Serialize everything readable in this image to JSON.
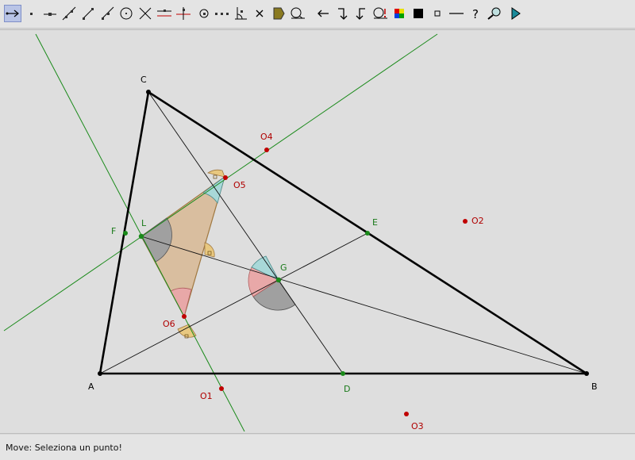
{
  "toolbar": {
    "tools": [
      {
        "name": "move-tool-icon",
        "active": true
      },
      {
        "name": "point-tool-icon"
      },
      {
        "name": "point-on-line-tool-icon"
      },
      {
        "name": "line-tool-icon"
      },
      {
        "name": "segment-tool-icon"
      },
      {
        "name": "ray-tool-icon"
      },
      {
        "name": "circle-tool-icon"
      },
      {
        "name": "intersection-tool-icon"
      },
      {
        "name": "parallel-tool-icon"
      },
      {
        "name": "perpendicular-tool-icon"
      },
      {
        "name": "center-tool-icon"
      },
      {
        "name": "midpoint-tool-icon"
      },
      {
        "name": "angle-tool-icon"
      },
      {
        "name": "delete-tool-icon"
      },
      {
        "name": "polygon-fill-tool-icon"
      },
      {
        "name": "text-tool-icon"
      },
      {
        "name": "undo-tool-icon"
      },
      {
        "name": "redo-tool-icon"
      },
      {
        "name": "back-tool-icon"
      },
      {
        "name": "macro-tool-icon"
      },
      {
        "name": "color-tool-icon"
      },
      {
        "name": "fill-tool-icon"
      },
      {
        "name": "point-style-tool-icon"
      },
      {
        "name": "line-style-tool-icon"
      },
      {
        "name": "help-tool-icon"
      },
      {
        "name": "zoom-tool-icon"
      },
      {
        "name": "animation-tool-icon"
      }
    ]
  },
  "status": {
    "text": "Move: Seleziona un punto!"
  },
  "colors": {
    "triangle": "#000000",
    "green_line": "#1a8a1a",
    "green_point": "#1a8a1a",
    "red_point": "#c00000",
    "red_label": "#b00000",
    "green_label": "#1a7a1a",
    "fill_triangle": "#d8b894",
    "angle_teal": "#a8d8d8",
    "angle_gray": "#a0a0a0",
    "angle_red": "#e8a8a8",
    "angle_orange": "#e8c880"
  },
  "labels": {
    "A": "A",
    "B": "B",
    "C": "C",
    "D": "D",
    "E": "E",
    "F": "F",
    "G": "G",
    "L": "L",
    "O1": "O1",
    "O2": "O2",
    "O3": "O3",
    "O4": "O4",
    "O5": "O5",
    "O6": "O6"
  }
}
